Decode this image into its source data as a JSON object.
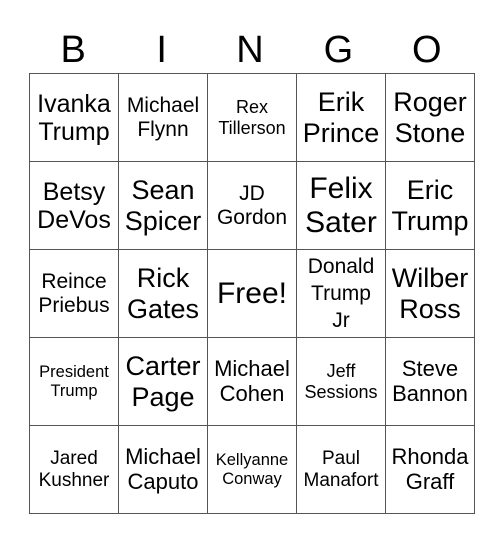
{
  "header": [
    "B",
    "I",
    "N",
    "G",
    "O"
  ],
  "grid": [
    [
      "Ivanka\nTrump",
      "Michael\nFlynn",
      "Rex\nTillerson",
      "Erik\nPrince",
      "Roger\nStone"
    ],
    [
      "Betsy\nDeVos",
      "Sean\nSpicer",
      "JD\nGordon",
      "Felix\nSater",
      "Eric\nTrump"
    ],
    [
      "Reince\nPriebus",
      "Rick\nGates",
      "Free!",
      "Donald\nTrump\nJr",
      "Wilber\nRoss"
    ],
    [
      "President\nTrump",
      "Carter\nPage",
      "Michael\nCohen",
      "Jeff\nSessions",
      "Steve\nBannon"
    ],
    [
      "Jared\nKushner",
      "Michael\nCaputo",
      "Kellyanne\nConway",
      "Paul\nManafort",
      "Rhonda\nGraff"
    ]
  ]
}
